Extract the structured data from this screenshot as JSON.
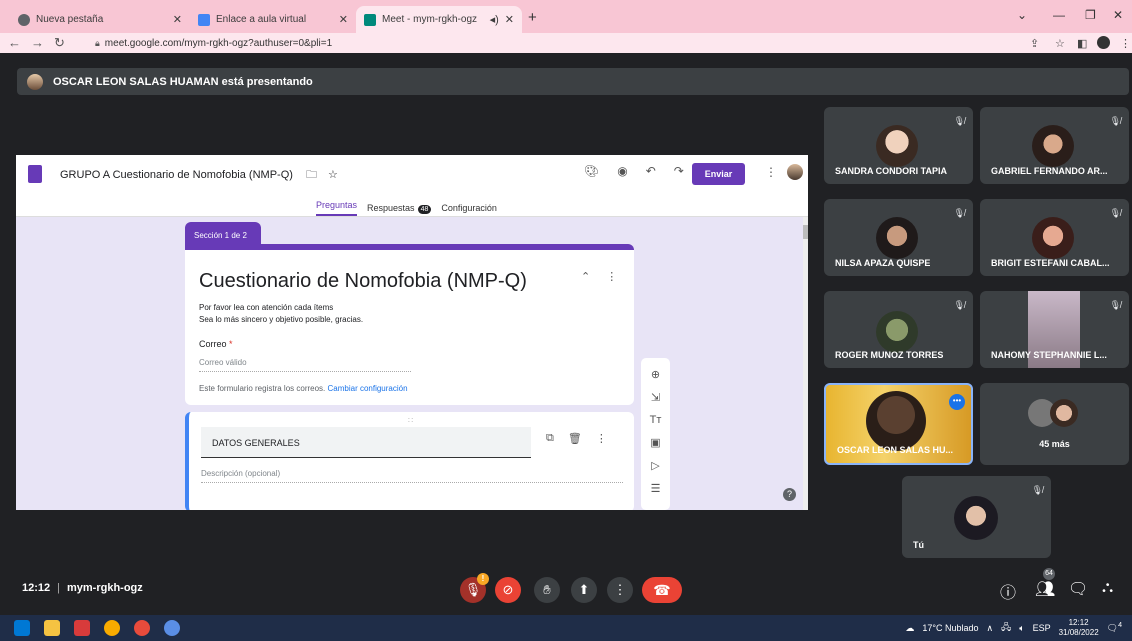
{
  "browser": {
    "tabs": [
      {
        "label": "Nueva pestaña",
        "fav_color": "#5f6368"
      },
      {
        "label": "Enlace a aula virtual",
        "fav_color": "#4285f4"
      },
      {
        "label": "Meet - mym-rgkh-ogz",
        "fav_color": "#00897b"
      }
    ],
    "url": "meet.google.com/mym-rgkh-ogz?authuser=0&pli=1"
  },
  "banner": {
    "text": "OSCAR LEON SALAS HUAMAN está presentando"
  },
  "form": {
    "title": "GRUPO A Cuestionario de Nomofobia (NMP-Q)",
    "send_label": "Enviar",
    "tabs": {
      "questions": "Preguntas",
      "responses": "Respuestas",
      "responses_count": "48",
      "settings": "Configuración"
    },
    "section_label": "Sección 1 de 2",
    "card_title": "Cuestionario de Nomofobia (NMP-Q)",
    "desc_line1": "Por favor lea con atención cada ítems",
    "desc_line2": "Sea lo más sincero y objetivo posible, gracias.",
    "email_label": "Correo",
    "email_required": "*",
    "email_placeholder": "Correo válido",
    "email_note": "Este formulario registra los correos.",
    "email_link": "Cambiar configuración",
    "section2_title": "DATOS GENERALES",
    "section2_desc": "Descripción (opcional)"
  },
  "participants": [
    {
      "name": "SANDRA CONDORI TAPIA"
    },
    {
      "name": "GABRIEL FERNANDO AR..."
    },
    {
      "name": "NILSA APAZA QUISPE"
    },
    {
      "name": "BRIGIT ESTEFANI CABAL..."
    },
    {
      "name": "ROGER MUNOZ TORRES"
    },
    {
      "name": "NAHOMY STEPHANNIE L..."
    },
    {
      "name": "OSCAR LEON SALAS HU..."
    },
    {
      "name": "45 más"
    },
    {
      "name": "Tú"
    }
  ],
  "meeting": {
    "time": "12:12",
    "code": "mym-rgkh-ogz",
    "mic_badge": "!",
    "people_count": "64"
  },
  "taskbar": {
    "weather": "17°C Nublado",
    "lang": "ESP",
    "time": "12:12",
    "date": "31/08/2022",
    "notif": "4"
  }
}
